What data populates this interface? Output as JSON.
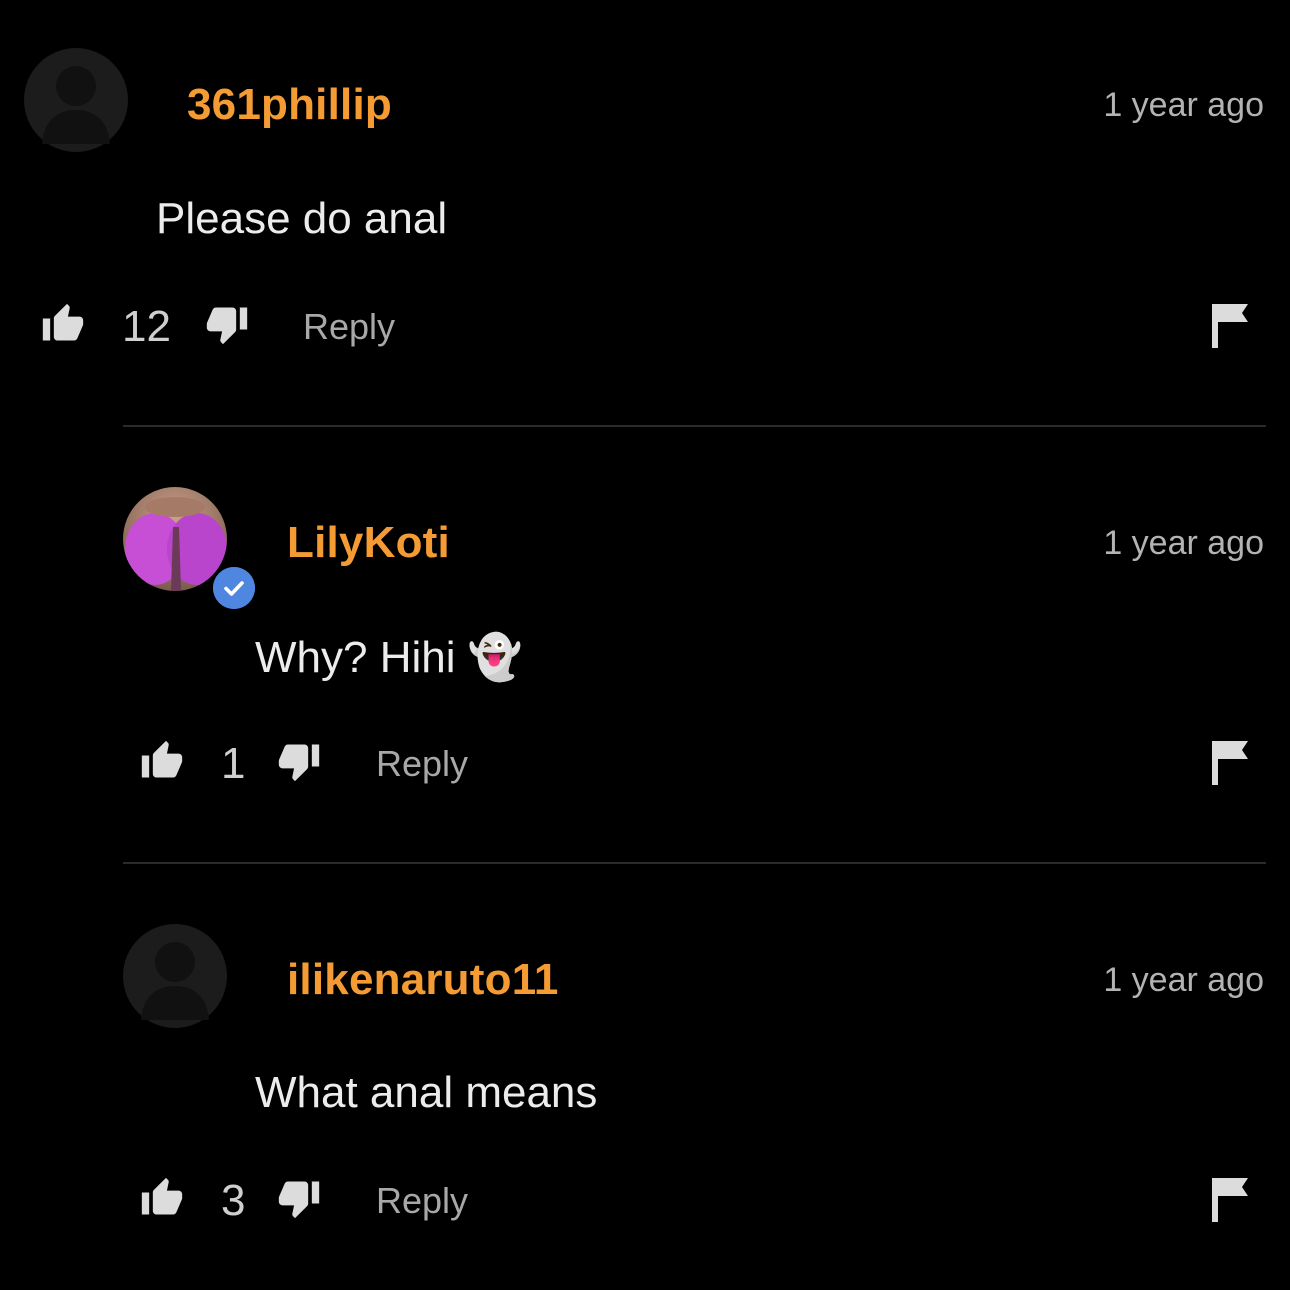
{
  "comments": [
    {
      "username": "361phillip",
      "time": "1 year ago",
      "text": "Please do anal",
      "likes": "12",
      "reply_label": "Reply",
      "avatar": "default-avatar",
      "verified": false
    },
    {
      "username": "LilyKoti",
      "time": "1 year ago",
      "text": "Why? Hihi 👻",
      "likes": "1",
      "reply_label": "Reply",
      "avatar": "profile-photo",
      "verified": true
    },
    {
      "username": "ilikenaruto11",
      "time": "1 year ago",
      "text": "What anal means",
      "likes": "3",
      "reply_label": "Reply",
      "avatar": "default-avatar",
      "verified": false
    }
  ],
  "colors": {
    "background": "#000000",
    "username": "#f49b34",
    "verified_badge": "#4f86e0",
    "divider": "#2b2b2b"
  },
  "icons": [
    "thumbs-up-icon",
    "thumbs-down-icon",
    "flag-icon",
    "verified-check-icon",
    "default-avatar-icon"
  ]
}
